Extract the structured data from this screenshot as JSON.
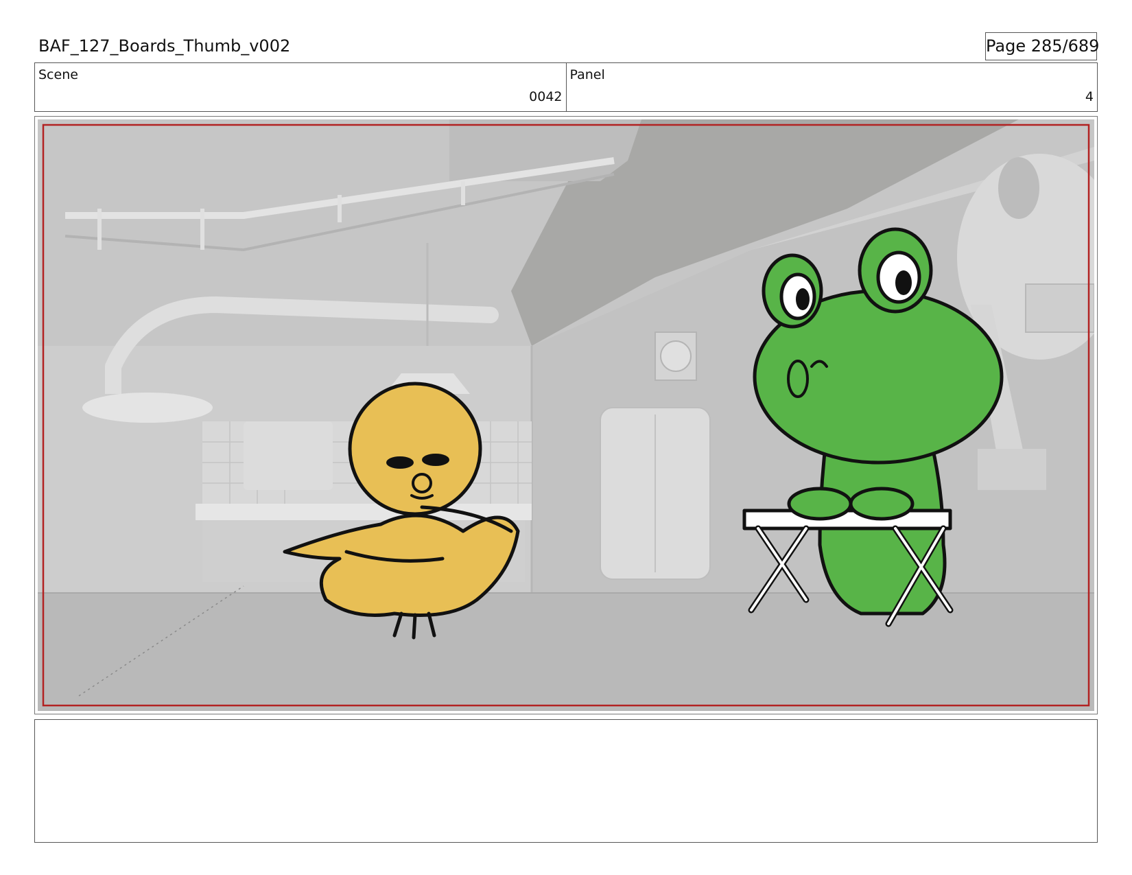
{
  "header": {
    "title": "BAF_127_Boards_Thumb_v002",
    "page": "Page 285/689"
  },
  "info": {
    "scene_label": "Scene",
    "scene_value": "0042",
    "panel_label": "Panel",
    "panel_value": "4"
  },
  "panel": {
    "safe_frame_color": "#b22222",
    "characters": [
      "yellow-chick",
      "green-frog"
    ],
    "colors": {
      "chick": "#e8bf55",
      "frog": "#58b448",
      "background": "#c9c9c9"
    }
  },
  "notes": {
    "text": ""
  }
}
